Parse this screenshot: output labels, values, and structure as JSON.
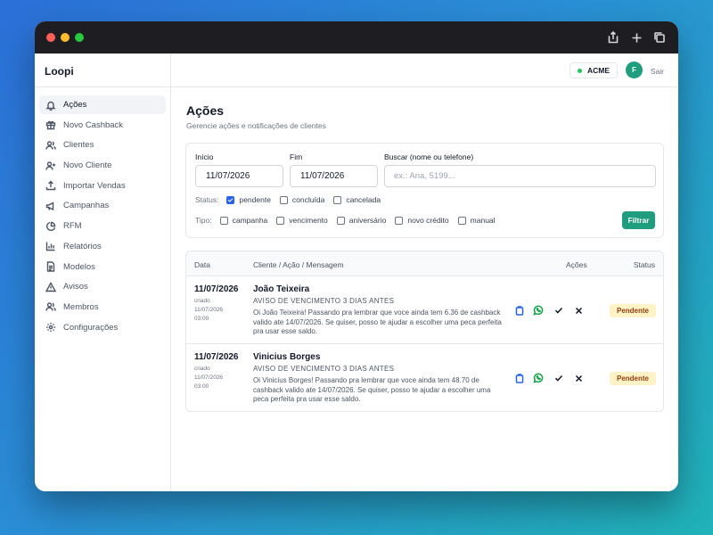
{
  "app": {
    "brand": "Loopi"
  },
  "sidebar": {
    "items": [
      {
        "label": "Ações",
        "icon": "bell-icon",
        "active": true
      },
      {
        "label": "Novo Cashback",
        "icon": "gift-icon"
      },
      {
        "label": "Clientes",
        "icon": "users-icon"
      },
      {
        "label": "Novo Cliente",
        "icon": "user-plus-icon"
      },
      {
        "label": "Importar Vendas",
        "icon": "upload-icon"
      },
      {
        "label": "Campanhas",
        "icon": "megaphone-icon"
      },
      {
        "label": "RFM",
        "icon": "pie-chart-icon"
      },
      {
        "label": "Relatórios",
        "icon": "bar-chart-icon"
      },
      {
        "label": "Modelos",
        "icon": "file-text-icon"
      },
      {
        "label": "Avisos",
        "icon": "alert-triangle-icon"
      },
      {
        "label": "Membros",
        "icon": "members-icon"
      },
      {
        "label": "Configurações",
        "icon": "gear-icon"
      }
    ]
  },
  "topbar": {
    "company": "ACME",
    "avatar_initial": "F",
    "logout": "Sair",
    "status_color": "#22c55e"
  },
  "page": {
    "title": "Ações",
    "subtitle": "Gerencie ações e notificações de clientes"
  },
  "filters": {
    "start_label": "Início",
    "start_value": "11/07/2026",
    "end_label": "Fim",
    "end_value": "11/07/2026",
    "search_label": "Buscar (nome ou telefone)",
    "search_placeholder": "ex.: Ana, 5199...",
    "status_label": "Status:",
    "status_options": [
      {
        "label": "pendente",
        "checked": true
      },
      {
        "label": "concluída",
        "checked": false
      },
      {
        "label": "cancelada",
        "checked": false
      }
    ],
    "type_label": "Tipo:",
    "type_options": [
      {
        "label": "campanha",
        "checked": false
      },
      {
        "label": "vencimento",
        "checked": false
      },
      {
        "label": "aniversário",
        "checked": false
      },
      {
        "label": "novo crédito",
        "checked": false
      },
      {
        "label": "manual",
        "checked": false
      }
    ],
    "submit": "Filtrar"
  },
  "table": {
    "headers": {
      "date": "Data",
      "client": "Cliente / Ação / Mensagem",
      "actions": "Ações",
      "status": "Status"
    },
    "rows": [
      {
        "date": "11/07/2026",
        "created_label": "criado",
        "created_date": "11/07/2026",
        "created_time": "03:00",
        "client": "João Teixeira",
        "action": "AVISO DE VENCIMENTO 3 DIAS ANTES",
        "message": "Oi João Teixeira! Passando pra lembrar que voce ainda tem 6.36 de cashback valido ate 14/07/2026. Se quiser, posso te ajudar a escolher uma peca perfeita pra usar esse saldo.",
        "status": "Pendente"
      },
      {
        "date": "11/07/2026",
        "created_label": "criado",
        "created_date": "11/07/2026",
        "created_time": "03:00",
        "client": "Vinicius Borges",
        "action": "AVISO DE VENCIMENTO 3 DIAS ANTES",
        "message": "Oi Vinicius Borges! Passando pra lembrar que voce ainda tem 48.70 de cashback valido ate 14/07/2026. Se quiser, posso te ajudar a escolher uma peca perfeita pra usar esse saldo.",
        "status": "Pendente"
      }
    ]
  },
  "colors": {
    "accent": "#1f9d7f",
    "checkbox": "#2563eb",
    "badge_bg": "#fef3c7",
    "badge_text": "#92400e",
    "whatsapp": "#16a34a",
    "copy": "#2563eb"
  }
}
